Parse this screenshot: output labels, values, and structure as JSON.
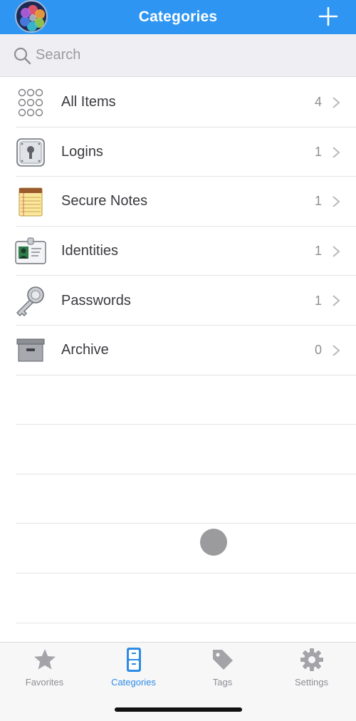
{
  "navbar": {
    "title": "Categories"
  },
  "search": {
    "placeholder": "Search"
  },
  "categories": [
    {
      "label": "All Items",
      "count": "4",
      "icon": "all-items-icon"
    },
    {
      "label": "Logins",
      "count": "1",
      "icon": "login-icon"
    },
    {
      "label": "Secure Notes",
      "count": "1",
      "icon": "notepad-icon"
    },
    {
      "label": "Identities",
      "count": "1",
      "icon": "id-card-icon"
    },
    {
      "label": "Passwords",
      "count": "1",
      "icon": "key-icon"
    },
    {
      "label": "Archive",
      "count": "0",
      "icon": "archive-box-icon"
    }
  ],
  "tabs": [
    {
      "label": "Favorites",
      "icon": "star-icon",
      "active": false
    },
    {
      "label": "Categories",
      "icon": "file-cabinet-icon",
      "active": true
    },
    {
      "label": "Tags",
      "icon": "tag-icon",
      "active": false
    },
    {
      "label": "Settings",
      "icon": "gear-icon",
      "active": false
    }
  ],
  "colors": {
    "accent": "#2e96f2",
    "active_tab": "#2e8be6",
    "inactive_tab": "#8e8e93"
  }
}
